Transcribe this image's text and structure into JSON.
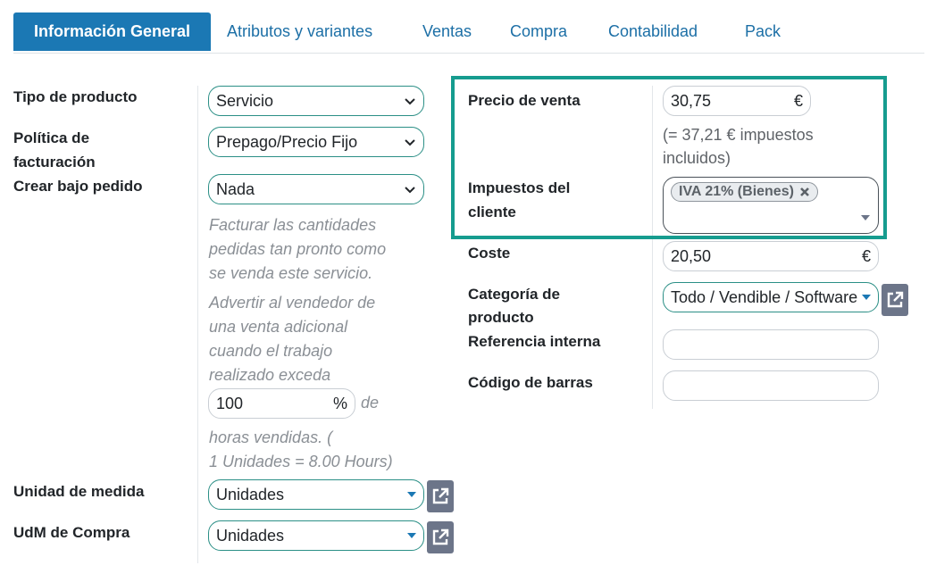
{
  "tabs": [
    {
      "label": "Información General",
      "active": true
    },
    {
      "label": "Atributos y variantes",
      "active": false
    },
    {
      "label": "Ventas",
      "active": false
    },
    {
      "label": "Compra",
      "active": false
    },
    {
      "label": "Contabilidad",
      "active": false
    },
    {
      "label": "Pack",
      "active": false
    }
  ],
  "left": {
    "product_type": {
      "label": "Tipo de producto",
      "value": "Servicio"
    },
    "invoice_policy": {
      "label_line1": "Política de",
      "label_line2": "facturación",
      "value": "Prepago/Precio Fijo"
    },
    "create_on_order": {
      "label": "Crear bajo pedido",
      "value": "Nada"
    },
    "help1": [
      "Facturar las cantidades",
      "pedidas tan pronto como",
      "se venda este servicio."
    ],
    "help2": [
      "Advertir al vendedor de",
      "una venta adicional",
      "cuando el trabajo",
      "realizado exceda"
    ],
    "percent": {
      "value": "100",
      "suffix": "%",
      "after": "de"
    },
    "help3": [
      "horas vendidas. (",
      "1 Unidades = 8.00 Hours)"
    ],
    "uom": {
      "label": "Unidad de medida",
      "value": "Unidades"
    },
    "uom_po": {
      "label": "UdM de Compra",
      "value": "Unidades"
    }
  },
  "right": {
    "sale_price": {
      "label": "Precio de venta",
      "value": "30,75",
      "currency": "€"
    },
    "tax_note": [
      "(= 37,21 € impuestos",
      "incluidos)"
    ],
    "customer_taxes": {
      "label_line1": "Impuestos del",
      "label_line2": "cliente",
      "tag": "IVA 21% (Bienes)"
    },
    "cost": {
      "label": "Coste",
      "value": "20,50",
      "currency": "€"
    },
    "category": {
      "label_line1": "Categoría de",
      "label_line2": "producto",
      "value": "Todo / Vendible / Software"
    },
    "internal_ref": {
      "label": "Referencia interna",
      "value": ""
    },
    "barcode": {
      "label": "Código de barras",
      "value": ""
    }
  },
  "colors": {
    "accent": "#1b78b4",
    "highlight": "#169c8f",
    "button": "#6c7589"
  },
  "icons": {
    "dropdown": "chevron-down-icon",
    "caret": "caret-down-icon",
    "external": "external-link-icon",
    "remove": "close-icon"
  }
}
